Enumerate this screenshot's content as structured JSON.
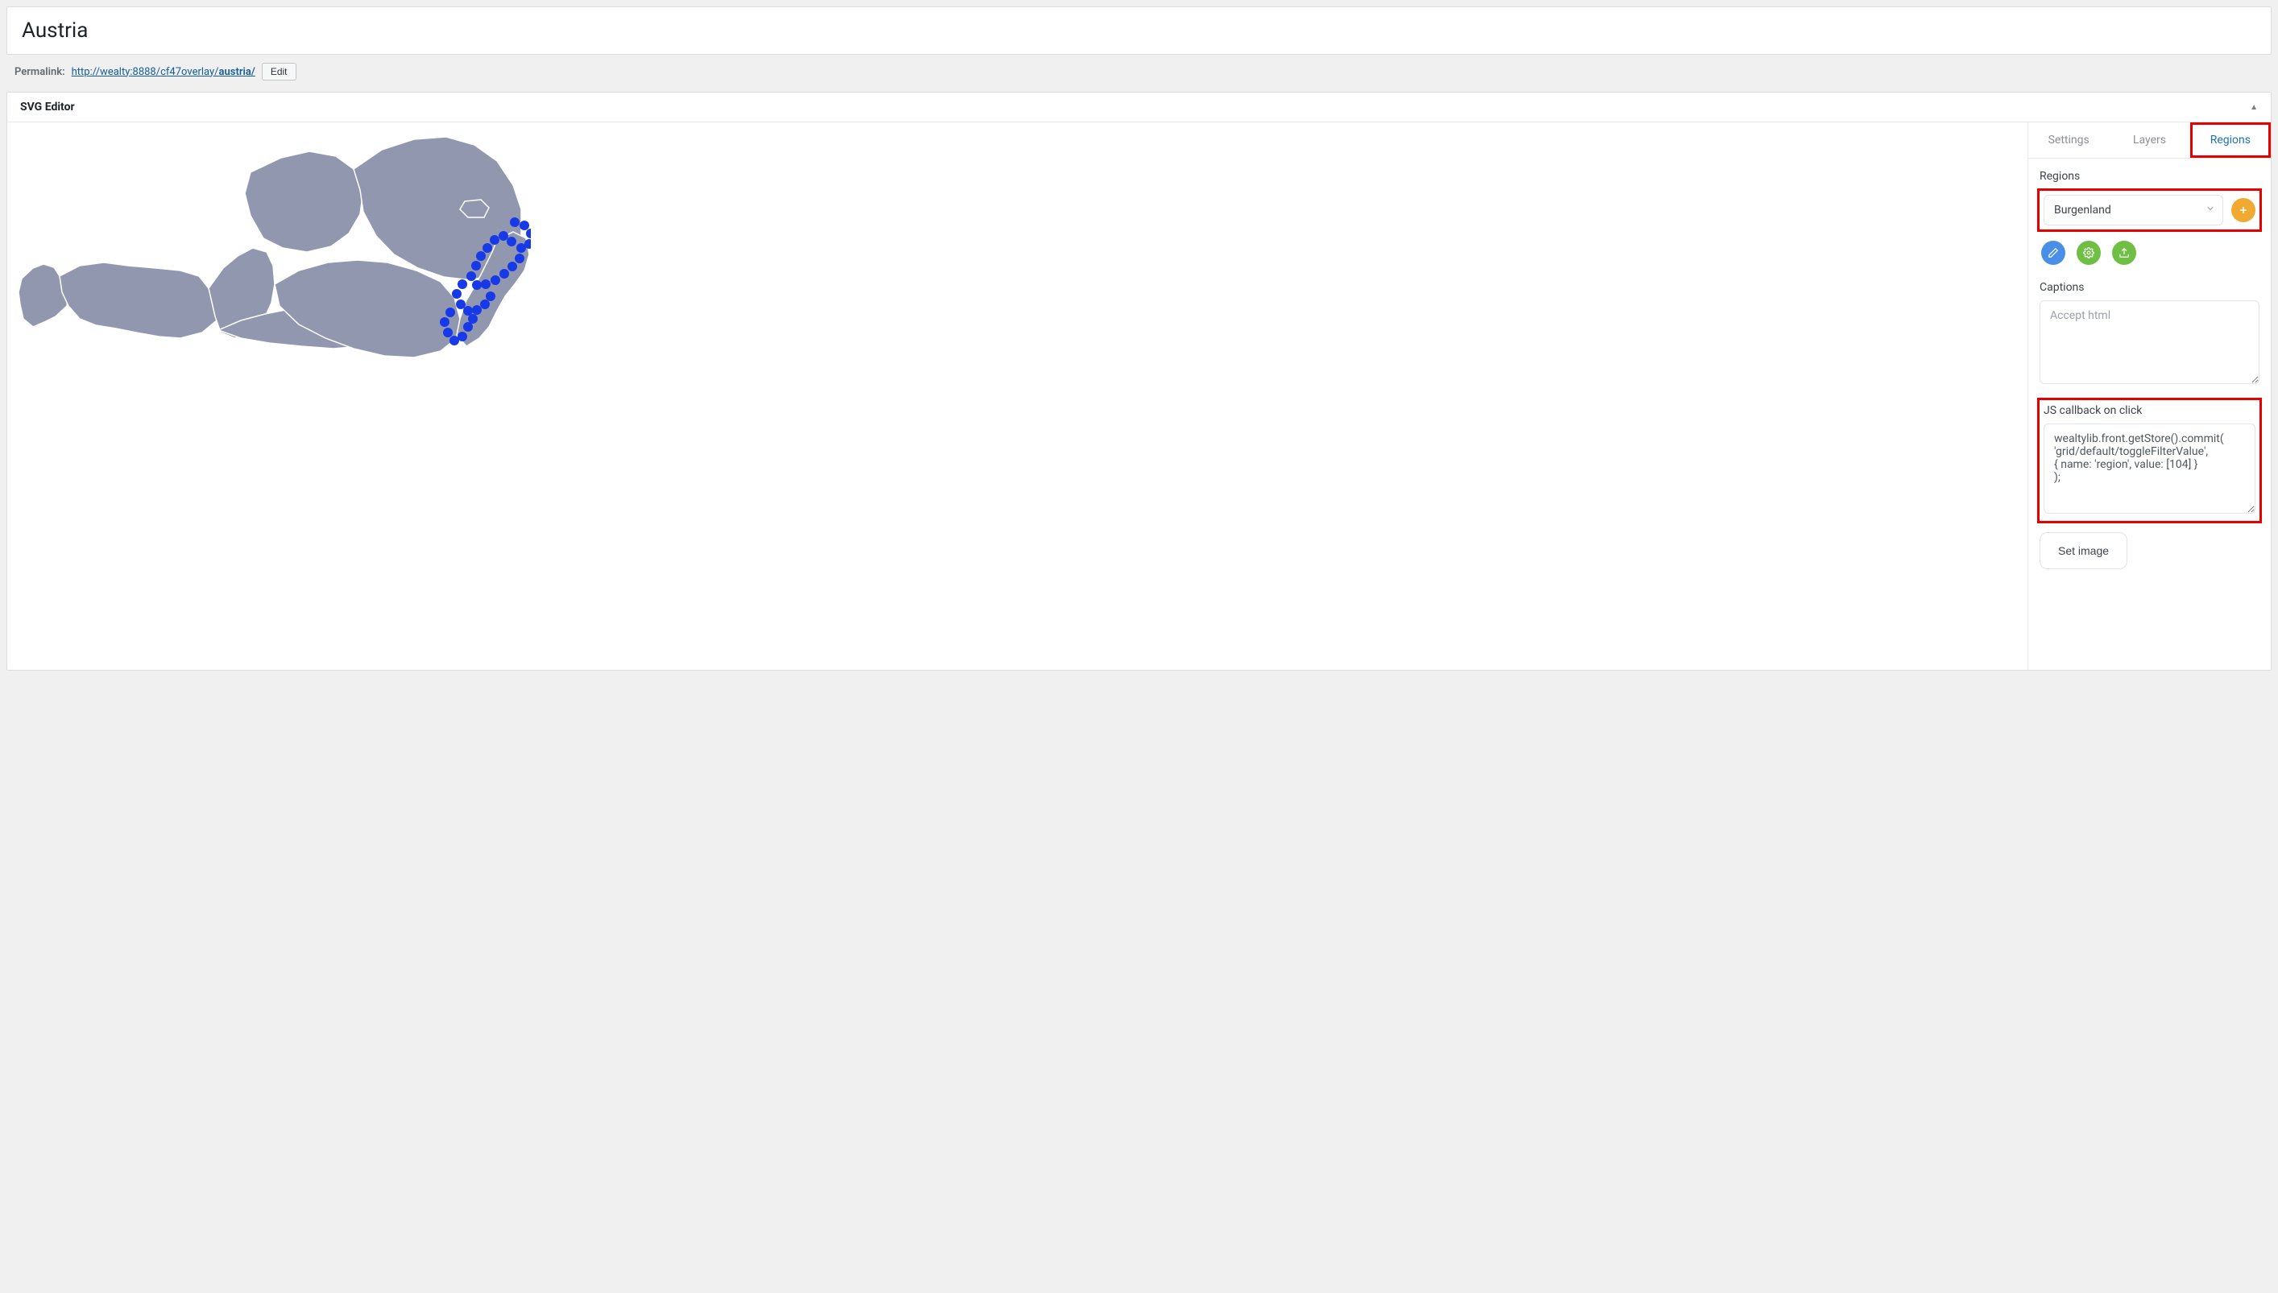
{
  "page": {
    "title": "Austria"
  },
  "permalink": {
    "label": "Permalink:",
    "base": "http://wealty:8888/cf47overlay/",
    "slug": "austria/",
    "edit_label": "Edit"
  },
  "panel": {
    "title": "SVG Editor"
  },
  "tabs": {
    "settings": "Settings",
    "layers": "Layers",
    "regions": "Regions",
    "active": "regions"
  },
  "regions": {
    "label": "Regions",
    "selected": "Burgenland"
  },
  "action_icons": {
    "add": "plus-icon",
    "edit": "pencil-icon",
    "settings": "gear-icon",
    "upload": "upload-icon"
  },
  "captions": {
    "label": "Captions",
    "placeholder": "Accept html"
  },
  "js_callback": {
    "label": "JS callback on click",
    "value": "wealtylib.front.getStore().commit(\n'grid/default/toggleFilterValue',\n{ name: 'region', value: [104] }\n);"
  },
  "set_image": {
    "label": "Set image"
  }
}
